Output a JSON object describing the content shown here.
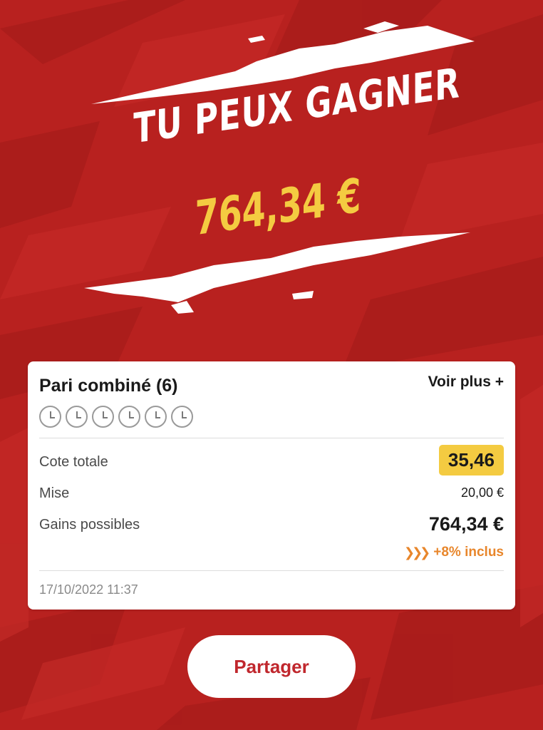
{
  "hero": {
    "headline": "TU PEUX GAGNER",
    "amount": "764,34 €"
  },
  "bet_card": {
    "title": "Pari combiné (6)",
    "see_more": "Voir plus +",
    "selection_count": 6,
    "rows": {
      "odds_label": "Cote totale",
      "odds_value": "35,46",
      "stake_label": "Mise",
      "stake_value": "20,00 €",
      "winnings_label": "Gains possibles",
      "winnings_value": "764,34 €",
      "bonus_text": "+8% inclus"
    },
    "timestamp": "17/10/2022 11:37"
  },
  "share_button": "Partager",
  "colors": {
    "background": "#b8211f",
    "accent_yellow": "#f4cb41",
    "bonus_orange": "#e8862b",
    "button_text_red": "#c0272d"
  },
  "icons": {
    "selection_status": "clock-icon",
    "bonus": "boost-chevrons-icon"
  }
}
